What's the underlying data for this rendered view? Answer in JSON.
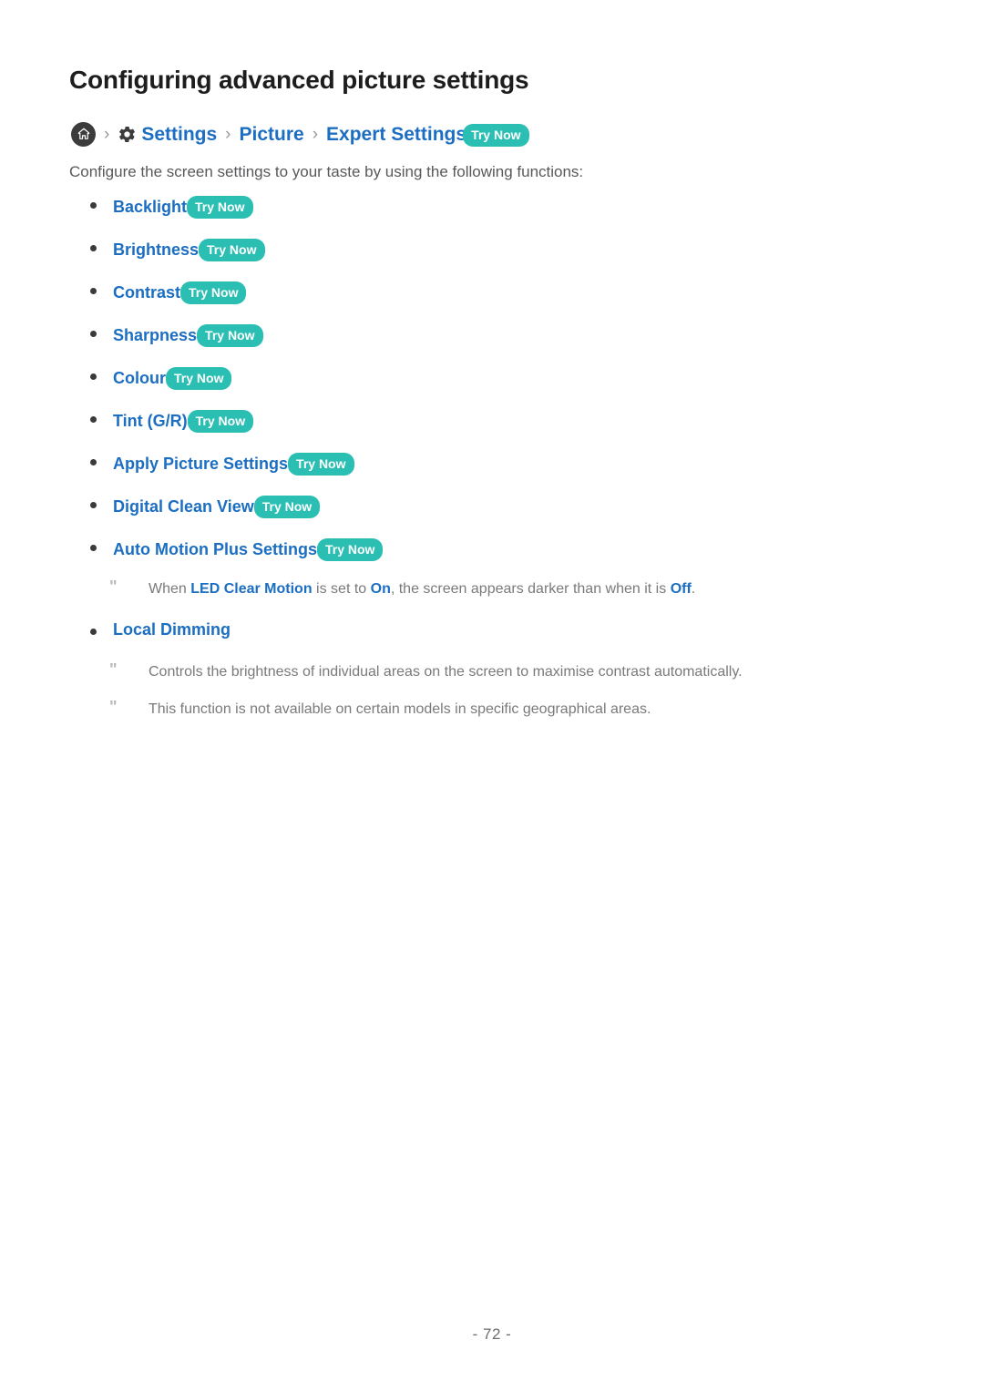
{
  "document": {
    "title": "Configuring advanced picture settings",
    "page_number": "- 72 -"
  },
  "breadcrumb": {
    "home_icon": "home-icon",
    "separator": "›",
    "gear_icon": "gear-icon",
    "items": [
      {
        "label": "Settings",
        "icon": "gear-icon"
      },
      {
        "label": "Picture",
        "icon": null
      },
      {
        "label": "Expert Settings",
        "icon": null
      }
    ],
    "try_now_label": "Try Now"
  },
  "intro": "Configure the screen settings to your taste by using the following functions:",
  "settings_list": [
    {
      "label": "Backlight",
      "try_now": "Try Now"
    },
    {
      "label": "Brightness",
      "try_now": "Try Now"
    },
    {
      "label": "Contrast",
      "try_now": "Try Now"
    },
    {
      "label": "Sharpness",
      "try_now": "Try Now"
    },
    {
      "label": "Colour",
      "try_now": "Try Now"
    },
    {
      "label": "Tint (G/R)",
      "try_now": "Try Now"
    },
    {
      "label": "Apply Picture Settings",
      "try_now": "Try Now"
    },
    {
      "label": "Digital Clean View",
      "try_now": "Try Now"
    },
    {
      "label": "Auto Motion Plus Settings",
      "try_now": "Try Now"
    }
  ],
  "notes": {
    "auto_motion_note": {
      "mark": "\"",
      "segment_1": "When ",
      "emphasis_1": "LED Clear Motion",
      "segment_2": " is set to ",
      "emphasis_2": "On",
      "segment_3": ", the screen appears darker than when it is ",
      "emphasis_3": "Off",
      "segment_4": "."
    },
    "local_dimming_note_1": {
      "mark": "\"",
      "text": "Controls the brightness of individual areas on the screen to maximise contrast automatically."
    },
    "local_dimming_note_2": {
      "mark": "\"",
      "text": "This function is not available on certain models in specific geographical areas."
    }
  },
  "local_dimming": {
    "label": "Local Dimming"
  },
  "colors": {
    "link_blue": "#1b6ec2",
    "badge_teal": "#2bbfb4",
    "body_gray": "#58585a",
    "note_gray": "#7a7a7c",
    "title_black": "#1d1d1d"
  }
}
